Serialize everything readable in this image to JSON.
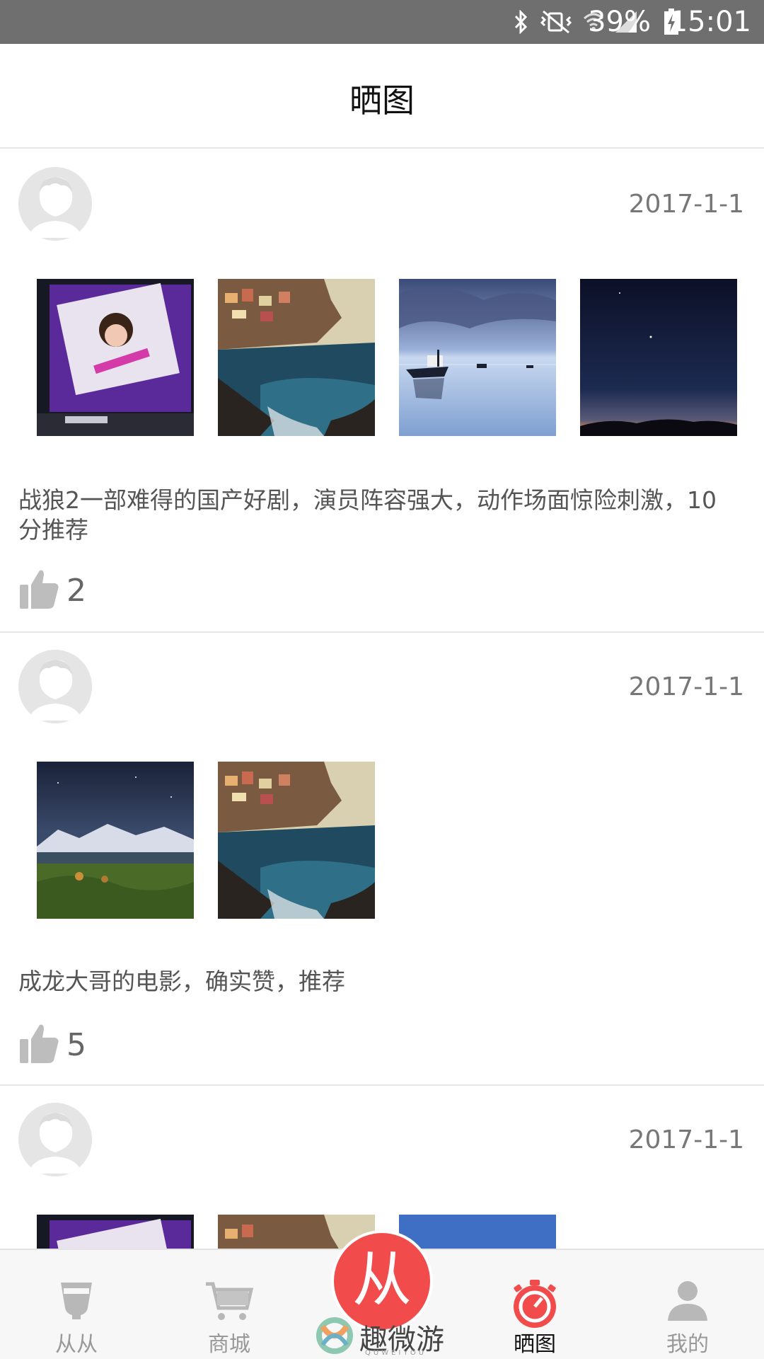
{
  "status_bar": {
    "battery_percent": "39%",
    "time": "15:01",
    "icons": [
      "bluetooth-icon",
      "vibrate-mute-icon",
      "wifi-icon",
      "signal-icon",
      "battery-charging-icon"
    ]
  },
  "header": {
    "title": "晒图"
  },
  "posts": [
    {
      "date": "2017-1-1",
      "images": [
        "billboard-night-photo",
        "cliff-village-sea-photo",
        "boat-lake-photo",
        "night-sky-horizon-photo"
      ],
      "text": "战狼2一部难得的国产好剧，演员阵容强大，动作场面惊险刺激，10分推荐",
      "likes": "2"
    },
    {
      "date": "2017-1-1",
      "images": [
        "mountain-lake-night-photo",
        "cliff-village-sea-photo"
      ],
      "text": "成龙大哥的电影，确实赞，推荐",
      "likes": "5"
    },
    {
      "date": "2017-1-1",
      "images": [
        "billboard-night-photo",
        "cliff-village-sea-photo",
        "blue-sky-photo"
      ]
    }
  ],
  "tabbar": {
    "items": [
      {
        "label": "从从",
        "icon": "cup-icon"
      },
      {
        "label": "商城",
        "icon": "cart-icon"
      },
      {
        "label": "晒图",
        "icon": "timer-icon",
        "active": true
      },
      {
        "label": "我的",
        "icon": "user-icon"
      }
    ],
    "center": {
      "glyph": "从",
      "brand_name": "趣微游",
      "brand_sub": "QUWEIYOU"
    }
  },
  "colors": {
    "accent": "#f24b4b",
    "status_bar": "#6f6f6f",
    "text_muted": "#777777"
  }
}
